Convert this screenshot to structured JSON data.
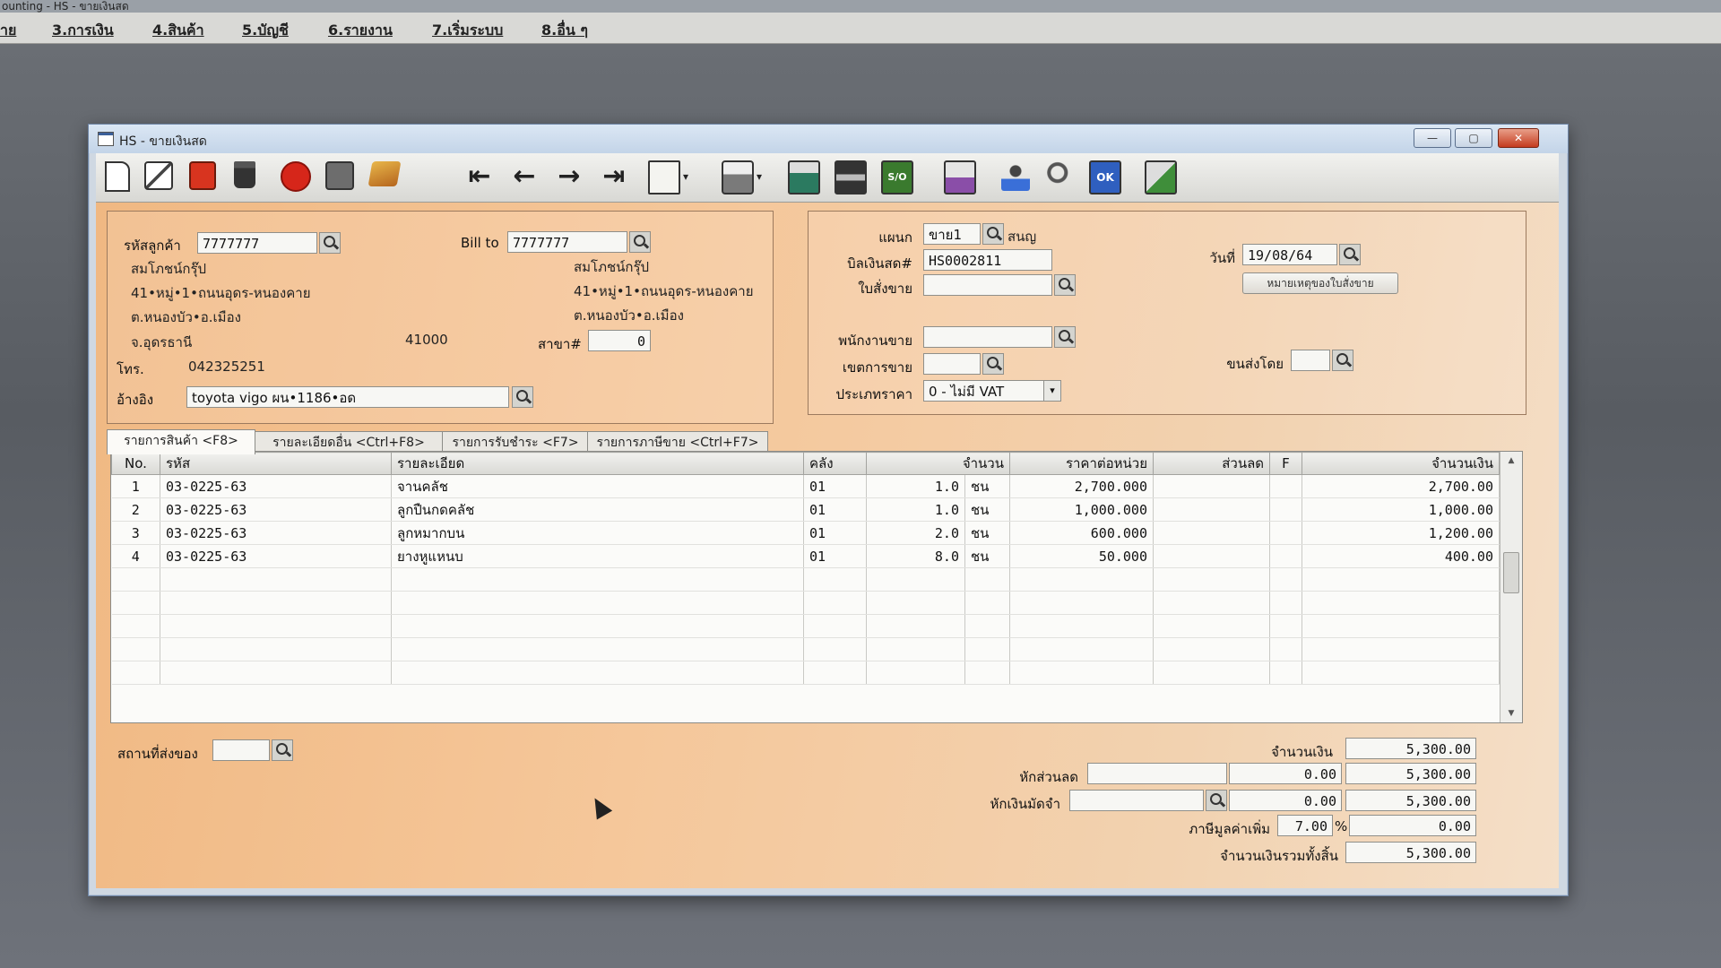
{
  "app": {
    "title": "ounting - HS - ขายเงินสด",
    "menu": [
      "าย",
      "3.การเงิน",
      "4.สินค้า",
      "5.บัญชี",
      "6.รายงาน",
      "7.เริ่มระบบ",
      "8.อื่น ๆ"
    ]
  },
  "window": {
    "title": "HS - ขายเงินสด",
    "buttons": {
      "minimize": "—",
      "maximize": "▢",
      "close": "✕"
    }
  },
  "toolbar": {
    "icons": [
      "new-document-icon",
      "edit-icon",
      "void-icon",
      "delete-icon",
      "cancel-icon",
      "save-icon",
      "book-icon",
      "first-record-icon",
      "previous-record-icon",
      "next-record-icon",
      "last-record-icon",
      "preview-icon",
      "print-icon",
      "calculator-icon",
      "register-icon",
      "so-icon",
      "report-icon",
      "approve-icon",
      "link-icon",
      "ok-icon",
      "export-icon"
    ],
    "labels": {
      "arrow_first": "⇤",
      "arrow_prev": "←",
      "arrow_next": "→",
      "arrow_last": "⇥",
      "so": "S/O",
      "ok": "OK",
      "dropdown": "▾"
    }
  },
  "customer": {
    "code_label": "รหัสลูกค้า",
    "code": "7777777",
    "name": "สมโภชน์กรุ๊ป",
    "addr1": "41•หมู่•1•ถนนอุดร-หนองคาย",
    "addr2": "ต.หนองบัว•อ.เมือง",
    "addr3": "จ.อุดรธานี",
    "zip": "41000",
    "phone_label": "โทร.",
    "phone": "042325251",
    "ref_label": "อ้างอิง",
    "ref": "toyota vigo ผน•1186•อด"
  },
  "bill_to": {
    "label": "Bill to",
    "code": "7777777",
    "name": "สมโภชน์กรุ๊ป",
    "addr1": "41•หมู่•1•ถนนอุดร-หนองคาย",
    "addr2": "ต.หนองบัว•อ.เมือง",
    "branch_label": "สาขา#",
    "branch": "0"
  },
  "document": {
    "dept_label": "แผนก",
    "dept": "ขาย1",
    "dept_name": "สนญ",
    "bill_label": "บิลเงินสด#",
    "bill_no": "HS0002811",
    "date_label": "วันที่",
    "date": "19/08/64",
    "so_label": "ใบสั่งขาย",
    "so": "",
    "so_note_button": "หมายเหตุของใบสั่งขาย",
    "salesman_label": "พนักงานขาย",
    "salesman": "",
    "area_label": "เขตการขาย",
    "area": "",
    "ship_by_label": "ขนส่งโดย",
    "ship_by": "",
    "price_type_label": "ประเภทราคา",
    "price_type": "0 - ไม่มี VAT"
  },
  "tabs": [
    "รายการสินค้า <F8>",
    "รายละเอียดอื่น <Ctrl+F8>",
    "รายการรับชำระ <F7>",
    "รายการภาษีขาย <Ctrl+F7>"
  ],
  "grid": {
    "columns": [
      "No.",
      "รหัส",
      "รายละเอียด",
      "คลัง",
      "จำนวน",
      "ราคาต่อหน่วย",
      "ส่วนลด",
      "F",
      "จำนวนเงิน"
    ],
    "rows": [
      {
        "no": "1",
        "code": "03-0225-63",
        "desc": "จานคลัช",
        "wh": "01",
        "qty": "1.0",
        "unit": "ชน",
        "price": "2,700.000",
        "disc": "",
        "f": "",
        "amount": "2,700.00"
      },
      {
        "no": "2",
        "code": "03-0225-63",
        "desc": "ลูกปืนกดคลัช",
        "wh": "01",
        "qty": "1.0",
        "unit": "ชน",
        "price": "1,000.000",
        "disc": "",
        "f": "",
        "amount": "1,000.00"
      },
      {
        "no": "3",
        "code": "03-0225-63",
        "desc": "ลูกหมากบน",
        "wh": "01",
        "qty": "2.0",
        "unit": "ชน",
        "price": "600.000",
        "disc": "",
        "f": "",
        "amount": "1,200.00"
      },
      {
        "no": "4",
        "code": "03-0225-63",
        "desc": "ยางหูแหนบ",
        "wh": "01",
        "qty": "8.0",
        "unit": "ชน",
        "price": "50.000",
        "disc": "",
        "f": "",
        "amount": "400.00"
      }
    ],
    "scroll": {
      "up": "▲",
      "down": "▼"
    }
  },
  "footer": {
    "ship_place_label": "สถานที่ส่งของ",
    "ship_place": "",
    "amount_label": "จำนวนเงิน",
    "amount": "5,300.00",
    "discount_label": "หักส่วนลด",
    "discount_text": "",
    "discount_value": "0.00",
    "after_discount": "5,300.00",
    "deposit_label": "หักเงินมัดจำ",
    "deposit_text": "",
    "deposit_value": "0.00",
    "after_deposit": "5,300.00",
    "vat_label": "ภาษีมูลค่าเพิ่ม",
    "vat_rate": "7.00",
    "vat_unit": "%",
    "vat_amount": "0.00",
    "total_label": "จำนวนเงินรวมทั้งสิ้น",
    "total": "5,300.00"
  }
}
